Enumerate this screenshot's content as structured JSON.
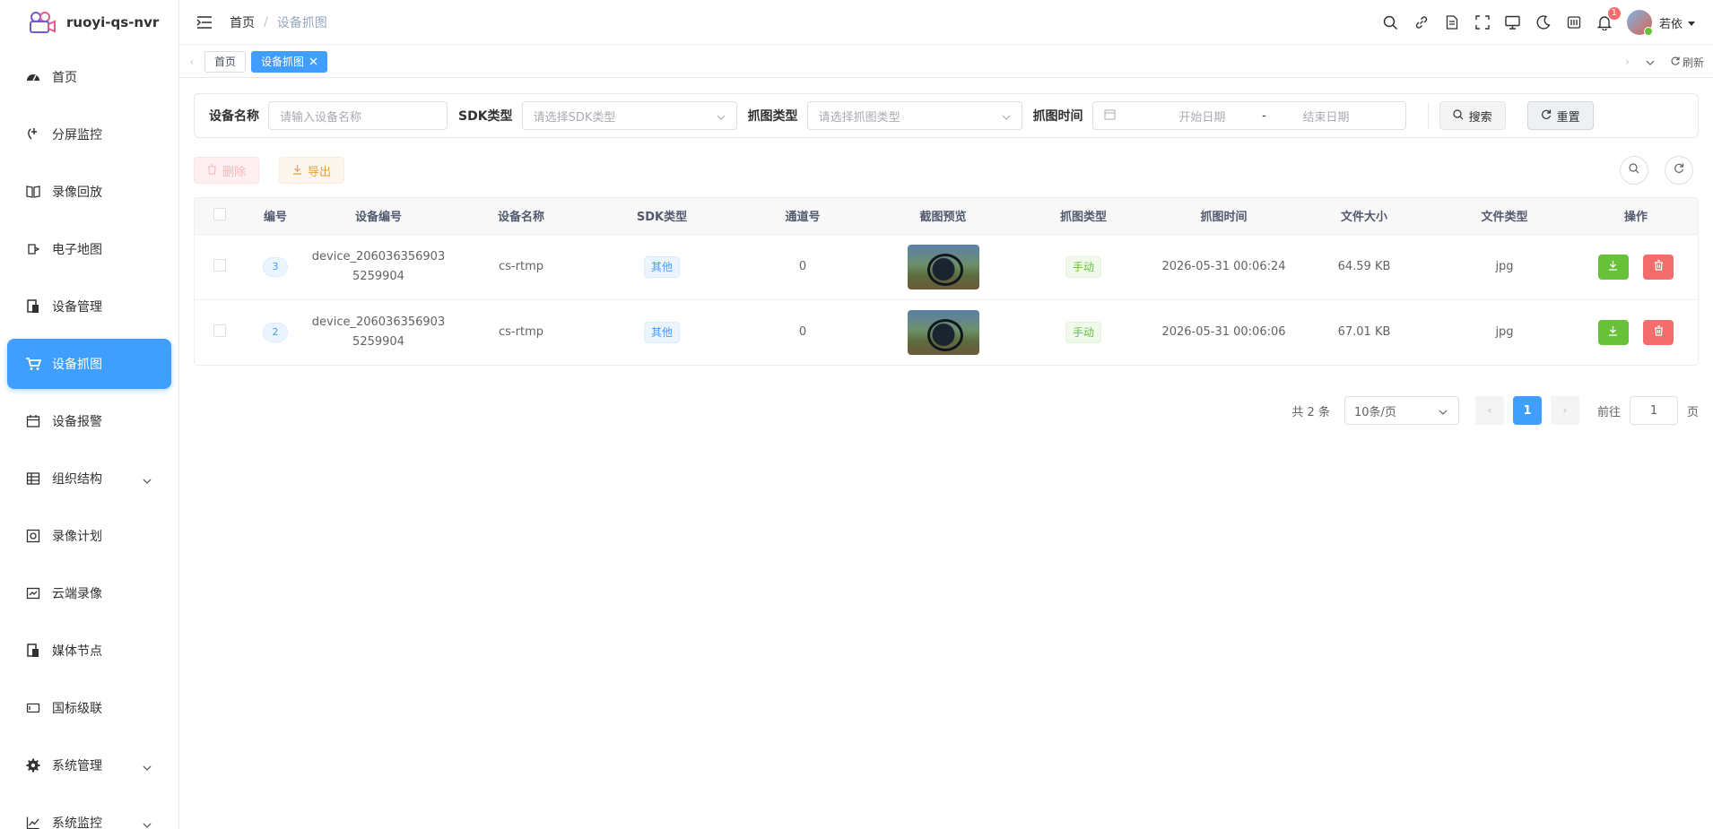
{
  "app": {
    "title": "ruoyi-qs-nvr"
  },
  "sidebar": {
    "items": [
      {
        "label": "首页",
        "icon": "dashboard-icon"
      },
      {
        "label": "分屏监控",
        "icon": "monitor-icon"
      },
      {
        "label": "录像回放",
        "icon": "book-icon"
      },
      {
        "label": "电子地图",
        "icon": "map-icon"
      },
      {
        "label": "设备管理",
        "icon": "device-icon"
      },
      {
        "label": "设备抓图",
        "icon": "cart-icon",
        "active": true
      },
      {
        "label": "设备报警",
        "icon": "calendar-icon"
      },
      {
        "label": "组织结构",
        "icon": "table-icon"
      },
      {
        "label": "录像计划",
        "icon": "plan-icon"
      },
      {
        "label": "云端录像",
        "icon": "cloud-icon"
      },
      {
        "label": "媒体节点",
        "icon": "node-icon"
      },
      {
        "label": "国标级联",
        "icon": "cascade-icon"
      },
      {
        "label": "系统管理",
        "icon": "gear-icon"
      },
      {
        "label": "系统监控",
        "icon": "chart-icon"
      }
    ]
  },
  "breadcrumb": {
    "home": "首页",
    "sep": "/",
    "current": "设备抓图"
  },
  "header": {
    "notification_count": "1",
    "user": "若依"
  },
  "tags": {
    "home": "首页",
    "active": "设备抓图",
    "refresh": "刷新"
  },
  "search": {
    "device_name_label": "设备名称",
    "device_name_placeholder": "请输入设备名称",
    "sdk_label": "SDK类型",
    "sdk_placeholder": "请选择SDK类型",
    "capture_type_label": "抓图类型",
    "capture_type_placeholder": "请选择抓图类型",
    "capture_time_label": "抓图时间",
    "start_date": "开始日期",
    "range_sep": "-",
    "end_date": "结束日期",
    "search_btn": "搜索",
    "reset_btn": "重置"
  },
  "toolbar": {
    "delete": "删除",
    "export": "导出"
  },
  "table": {
    "headers": [
      "编号",
      "设备编号",
      "设备名称",
      "SDK类型",
      "通道号",
      "截图预览",
      "抓图类型",
      "抓图时间",
      "文件大小",
      "文件类型",
      "操作"
    ],
    "rows": [
      {
        "id": "3",
        "device_no_1": "device_206036356903",
        "device_no_2": "5259904",
        "device_name": "cs-rtmp",
        "sdk": "其他",
        "channel": "0",
        "capture_type": "手动",
        "time": "2026-05-31 00:06:24",
        "size": "64.59 KB",
        "file_type": "jpg"
      },
      {
        "id": "2",
        "device_no_1": "device_206036356903",
        "device_no_2": "5259904",
        "device_name": "cs-rtmp",
        "sdk": "其他",
        "channel": "0",
        "capture_type": "手动",
        "time": "2026-05-31 00:06:06",
        "size": "67.01 KB",
        "file_type": "jpg"
      }
    ]
  },
  "pagination": {
    "total": "共 2 条",
    "page_size": "10条/页",
    "current": "1",
    "goto": "前往",
    "goto_value": "1",
    "page_unit": "页"
  },
  "colors": {
    "primary": "#409eff",
    "success": "#67c23a",
    "danger": "#f56c6c",
    "warning": "#e6a23c"
  }
}
